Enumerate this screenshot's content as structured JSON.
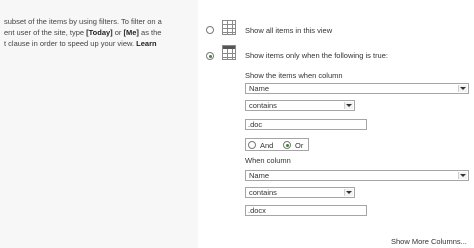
{
  "description": {
    "line1": "subset of the items by using filters. To filter on a",
    "line2_pre": "ent user of the site, type ",
    "token_today": "[Today]",
    "line2_mid": " or ",
    "token_me": "[Me]",
    "line2_post": " as the",
    "line3_pre": "t clause in order to speed up your view. ",
    "learn": "Learn"
  },
  "options": {
    "show_all": "Show all items in this view",
    "show_filtered": "Show items only when the following is true:"
  },
  "filter": {
    "show_items_label": "Show the items when column",
    "column1": "Name",
    "operator1": "contains",
    "value1": ".doc",
    "and_label": "And",
    "or_label": "Or",
    "when_column_label": "When column",
    "column2": "Name",
    "operator2": "contains",
    "value2": ".docx"
  },
  "footer": {
    "show_more": "Show More Columns..."
  }
}
